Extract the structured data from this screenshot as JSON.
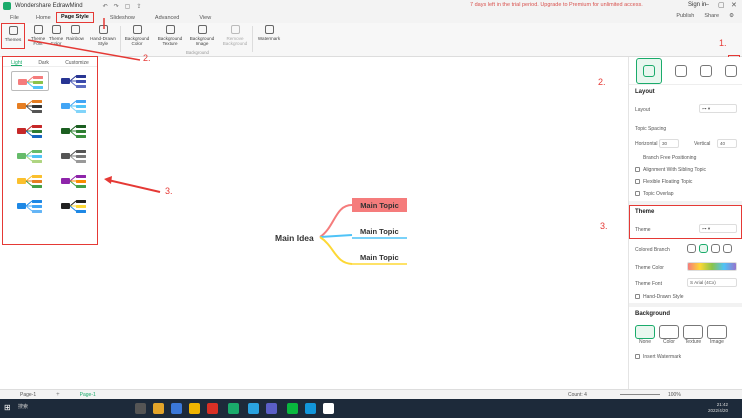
{
  "app": {
    "name": "Wondershare EdrawMind",
    "promo": "7 days left in the trial period. Upgrade to Premium for unlimited access.",
    "sign_in": "Sign in"
  },
  "menu": {
    "tabs": [
      "File",
      "Home",
      "Page Style",
      "Slideshow",
      "Advanced",
      "View"
    ],
    "active": "Page Style",
    "actions": [
      "Publish",
      "Share"
    ]
  },
  "ribbon": {
    "buttons": [
      {
        "label": "Themes",
        "enabled": true
      },
      {
        "label": "Theme Font",
        "enabled": true
      },
      {
        "label": "Theme Color",
        "enabled": true
      },
      {
        "label": "Rainbow",
        "enabled": true
      },
      {
        "label": "Hand-Drawn Style",
        "enabled": true
      },
      {
        "label": "Background Color",
        "enabled": true
      },
      {
        "label": "Background Texture",
        "enabled": true
      },
      {
        "label": "Background Image",
        "enabled": true
      },
      {
        "label": "Remove Background",
        "enabled": false
      },
      {
        "label": "Watermark",
        "enabled": true
      }
    ],
    "group_label": "Background"
  },
  "theme_panel": {
    "tabs": [
      "Light",
      "Dark",
      "Customize"
    ],
    "active_tab": "Light",
    "thumbnails": [
      {
        "name": "theme-1",
        "colors": [
          "#f57c7c",
          "#8bc34a",
          "#4fc3f7"
        ],
        "selected": true
      },
      {
        "name": "theme-2",
        "colors": [
          "#283593",
          "#3949ab",
          "#5c6bc0"
        ],
        "selected": false
      },
      {
        "name": "theme-3",
        "colors": [
          "#e67e22",
          "#333333",
          "#555555"
        ],
        "selected": false
      },
      {
        "name": "theme-4",
        "colors": [
          "#42a5f5",
          "#4fc3f7",
          "#81d4fa"
        ],
        "selected": false
      },
      {
        "name": "theme-5",
        "colors": [
          "#c62828",
          "#2e7d32",
          "#1565c0"
        ],
        "selected": false
      },
      {
        "name": "theme-6",
        "colors": [
          "#1b5e20",
          "#2e7d32",
          "#388e3c"
        ],
        "selected": false
      },
      {
        "name": "theme-7",
        "colors": [
          "#66bb6a",
          "#4fc3f7",
          "#aed581"
        ],
        "selected": false
      },
      {
        "name": "theme-8",
        "colors": [
          "#555555",
          "#777777",
          "#999999"
        ],
        "selected": false
      },
      {
        "name": "theme-9",
        "colors": [
          "#fbc02d",
          "#e67e22",
          "#43a047"
        ],
        "selected": false
      },
      {
        "name": "theme-10",
        "colors": [
          "#8e24aa",
          "#fb8c00",
          "#43a047"
        ],
        "selected": false
      },
      {
        "name": "theme-11",
        "colors": [
          "#1e88e5",
          "#42a5f5",
          "#64b5f6"
        ],
        "selected": false
      },
      {
        "name": "theme-12",
        "colors": [
          "#212121",
          "#fdd835",
          "#1e88e5"
        ],
        "selected": false
      }
    ]
  },
  "annotations": [
    "1.",
    "2.",
    "2.",
    "3.",
    "3."
  ],
  "mindmap": {
    "main_idea": "Main Idea",
    "topics": [
      "Main Topic",
      "Main Topic",
      "Main Topic"
    ],
    "branch_colors": [
      "#f57c7c",
      "#4fc3f7",
      "#fdd835"
    ]
  },
  "sidebar": {
    "layout_head": "Layout",
    "layout_label": "Layout",
    "topic_spacing": "Topic Spacing",
    "horizontal_label": "Horizontal",
    "horizontal_value": "30",
    "vertical_label": "Vertical",
    "vertical_value": "40",
    "options": [
      "Branch Free Positioning",
      "Alignment With Sibling Topic",
      "Flexible Floating Topic",
      "Topic Overlap"
    ],
    "theme_head": "Theme",
    "theme_label": "Theme",
    "colored_branch": "Colored Branch",
    "theme_color": "Theme Color",
    "theme_font": "Theme Font",
    "theme_font_value": "S Arial (4Cx)",
    "hand_drawn": "Hand-Drawn Style",
    "background_head": "Background",
    "bg_options": [
      "None",
      "Color",
      "Texture",
      "Image"
    ],
    "insert_watermark": "Insert Watermark"
  },
  "status": {
    "page_tabs": [
      "Page-1",
      "Page-1"
    ],
    "count": "Count: 4",
    "zoom": "100%"
  },
  "taskbar": {
    "search": "搜索",
    "time": "21:42",
    "date": "2022/4/20"
  }
}
